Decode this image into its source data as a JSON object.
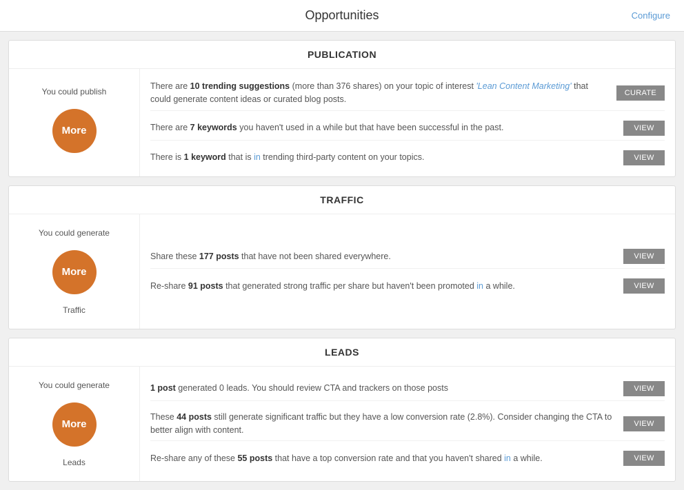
{
  "header": {
    "title": "Opportunities",
    "configure_label": "Configure"
  },
  "sections": [
    {
      "id": "publication",
      "header": "PUBLICATION",
      "left": {
        "top_label": "You could publish",
        "circle_label": "More",
        "bottom_label": ""
      },
      "rows": [
        {
          "text_parts": [
            {
              "text": "There are ",
              "style": "normal"
            },
            {
              "text": "10 trending suggestions",
              "style": "bold"
            },
            {
              "text": " (more than 376 shares) on your topic of interest ",
              "style": "normal"
            },
            {
              "text": "'Lean Content Marketing'",
              "style": "italic-blue"
            },
            {
              "text": " that could generate content ideas or curated blog posts.",
              "style": "normal"
            }
          ],
          "button": "CURATE"
        },
        {
          "text_parts": [
            {
              "text": "There are ",
              "style": "normal"
            },
            {
              "text": "7 keywords",
              "style": "bold"
            },
            {
              "text": " you haven't used in a while but that have been successful in the past.",
              "style": "normal"
            }
          ],
          "button": "VIEW"
        },
        {
          "text_parts": [
            {
              "text": "There is ",
              "style": "normal"
            },
            {
              "text": "1 keyword",
              "style": "bold"
            },
            {
              "text": " that is ",
              "style": "normal"
            },
            {
              "text": "in",
              "style": "blue"
            },
            {
              "text": " trending third-party content on your topics.",
              "style": "normal"
            }
          ],
          "button": "VIEW"
        }
      ]
    },
    {
      "id": "traffic",
      "header": "TRAFFIC",
      "left": {
        "top_label": "You could generate",
        "circle_label": "More",
        "bottom_label": "Traffic"
      },
      "rows": [
        {
          "text_parts": [
            {
              "text": "Share these ",
              "style": "normal"
            },
            {
              "text": "177 posts",
              "style": "bold"
            },
            {
              "text": " that have not been shared everywhere.",
              "style": "normal"
            }
          ],
          "button": "VIEW"
        },
        {
          "text_parts": [
            {
              "text": "Re-share ",
              "style": "normal"
            },
            {
              "text": "91 posts",
              "style": "bold"
            },
            {
              "text": " that generated strong traffic per share but haven't been promoted ",
              "style": "normal"
            },
            {
              "text": "in",
              "style": "blue"
            },
            {
              "text": " a while.",
              "style": "normal"
            }
          ],
          "button": "VIEW"
        }
      ]
    },
    {
      "id": "leads",
      "header": "LEADS",
      "left": {
        "top_label": "You could generate",
        "circle_label": "More",
        "bottom_label": "Leads"
      },
      "rows": [
        {
          "text_parts": [
            {
              "text": "1 post",
              "style": "bold"
            },
            {
              "text": " generated 0 leads. You should review CTA and trackers on those posts",
              "style": "normal"
            }
          ],
          "button": "VIEW"
        },
        {
          "text_parts": [
            {
              "text": "These ",
              "style": "normal"
            },
            {
              "text": "44 posts",
              "style": "bold"
            },
            {
              "text": " still generate significant traffic but they have a low conversion rate (2.8%). Consider changing the CTA to better align with content.",
              "style": "normal"
            }
          ],
          "button": "VIEW"
        },
        {
          "text_parts": [
            {
              "text": "Re-share any of these ",
              "style": "normal"
            },
            {
              "text": "55 posts",
              "style": "bold"
            },
            {
              "text": " that have a top conversion rate and that you haven't shared ",
              "style": "normal"
            },
            {
              "text": "in",
              "style": "blue"
            },
            {
              "text": " a while.",
              "style": "normal"
            }
          ],
          "button": "VIEW"
        }
      ]
    }
  ]
}
